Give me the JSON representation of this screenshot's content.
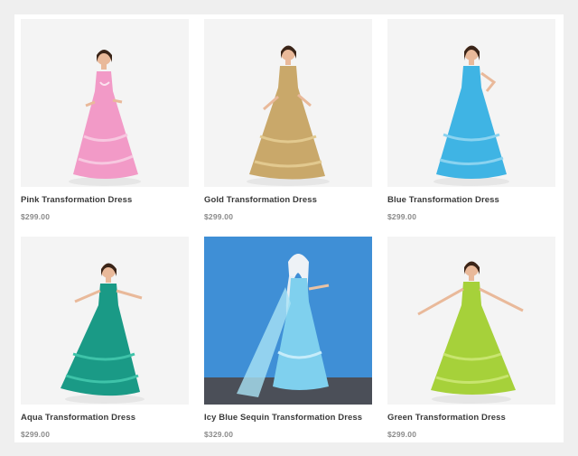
{
  "products": [
    {
      "name": "Pink Transformation Dress",
      "price": "$299.00",
      "image_icon": "pink-dress-photo",
      "dress_color": "#f29ac7",
      "bg_color": "#f4f4f4"
    },
    {
      "name": "Gold Transformation Dress",
      "price": "$299.00",
      "image_icon": "gold-dress-photo",
      "dress_color": "#c9a86a",
      "bg_color": "#f4f4f4"
    },
    {
      "name": "Blue Transformation Dress",
      "price": "$299.00",
      "image_icon": "blue-dress-photo",
      "dress_color": "#3fb4e4",
      "bg_color": "#f4f4f4"
    },
    {
      "name": "Aqua Transformation Dress",
      "price": "$299.00",
      "image_icon": "aqua-dress-photo",
      "dress_color": "#1a9a86",
      "bg_color": "#f4f4f4"
    },
    {
      "name": "Icy Blue Sequin Transformation Dress",
      "price": "$329.00",
      "image_icon": "icy-blue-dress-photo",
      "dress_color": "#7fd0ee",
      "bg_color": "#3f8fd6"
    },
    {
      "name": "Green Transformation Dress",
      "price": "$299.00",
      "image_icon": "green-dress-photo",
      "dress_color": "#a6d13a",
      "bg_color": "#f4f4f4"
    }
  ]
}
